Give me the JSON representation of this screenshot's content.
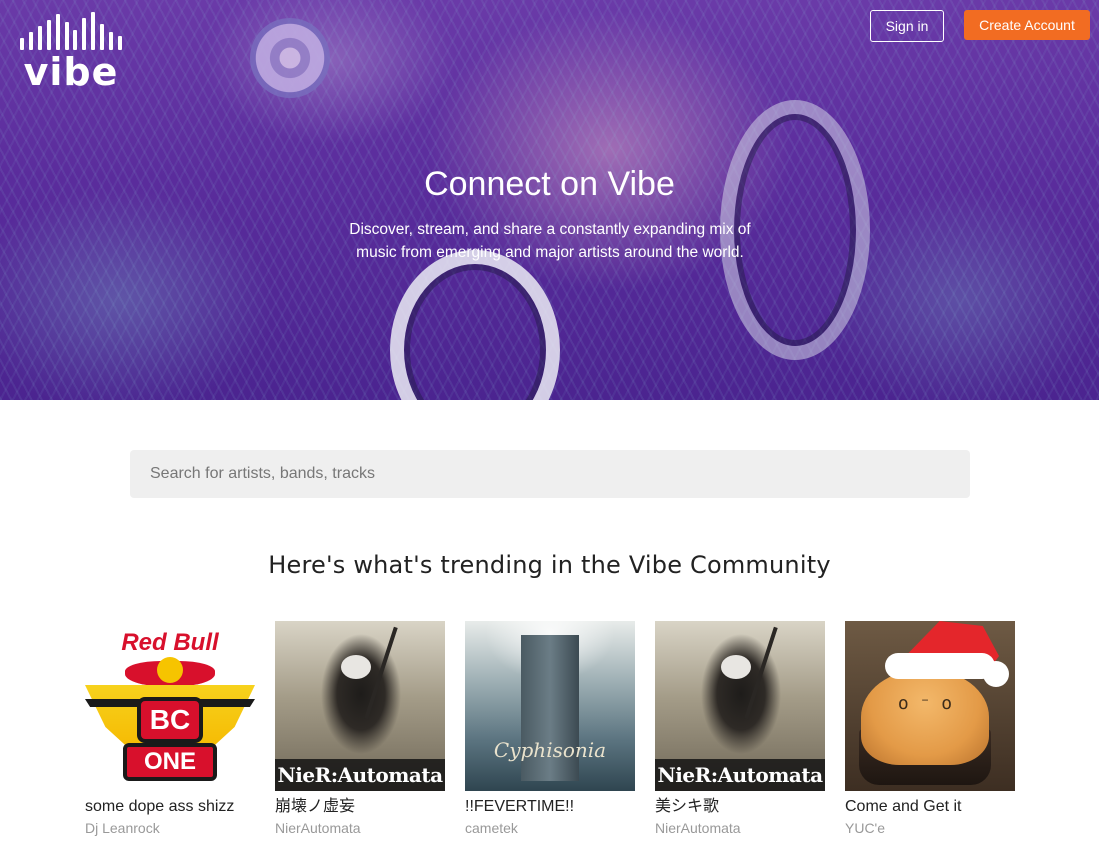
{
  "header": {
    "logo_text": "vibe",
    "signin_label": "Sign in",
    "create_account_label": "Create Account"
  },
  "hero": {
    "title": "Connect on Vibe",
    "subtitle": "Discover, stream, and share a constantly expanding mix of music from emerging and major artists around the world."
  },
  "search": {
    "placeholder": "Search for artists, bands, tracks"
  },
  "trending": {
    "heading": "Here's what's trending in the Vibe Community",
    "tracks": [
      {
        "title": "some dope ass shizz",
        "artist": "Dj Leanrock",
        "cover_text_top": "Red Bull",
        "cover_text_mid": "BC",
        "cover_text_bottom": "ONE"
      },
      {
        "title": "崩壊ノ虚妄",
        "artist": "NierAutomata",
        "cover_text": "NieR:Automata"
      },
      {
        "title": "!!FEVERTIME!!",
        "artist": "cametek",
        "cover_text": "Cyphisonia"
      },
      {
        "title": "美シキ歌",
        "artist": "NierAutomata",
        "cover_text": "NieR:Automata"
      },
      {
        "title": "Come and Get it",
        "artist": "YUC'e",
        "cover_text": "o ⁻ o"
      }
    ]
  },
  "colors": {
    "accent": "#f26c22",
    "hero_overlay": "#5a2c9c"
  },
  "icons": {
    "logo": "vibe-logo-icon"
  }
}
